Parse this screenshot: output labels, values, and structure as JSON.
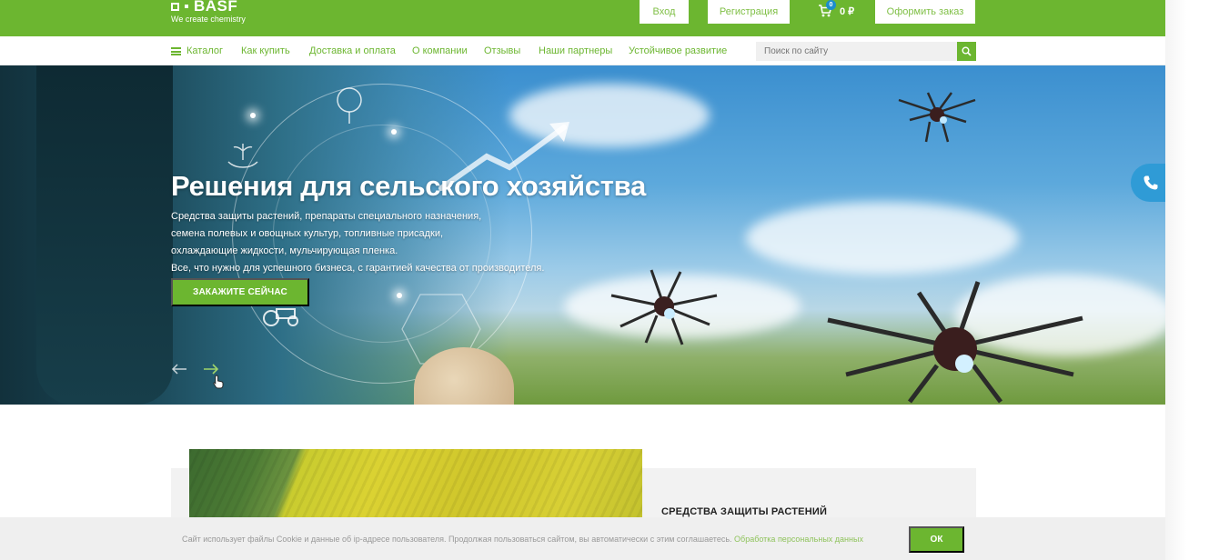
{
  "header": {
    "logo_text": "BASF",
    "logo_tagline": "We create chemistry",
    "login_label": "Вход",
    "register_label": "Регистрация",
    "cart_count": "0",
    "cart_total": "0 ₽",
    "checkout_label": "Оформить заказ",
    "brand_color": "#6cb630"
  },
  "nav": {
    "items": [
      {
        "label": "Каталог"
      },
      {
        "label": "Как купить"
      },
      {
        "label": "Доставка и оплата"
      },
      {
        "label": "О компании"
      },
      {
        "label": "Отзывы"
      },
      {
        "label": "Наши партнеры"
      },
      {
        "label": "Устойчивое развитие"
      }
    ],
    "search_placeholder": "Поиск по сайту"
  },
  "hero": {
    "title": "Решения для сельского хозяйства",
    "lines": [
      "Средства защиты растений, препараты специального назначения,",
      "семена полевых и овощных культур, топливные присадки,",
      "охлаждающие жидкости, мульчирующая пленка.",
      "Все, что нужно для успешного бизнеса, с гарантией качества от производителя."
    ],
    "cta_label": "ЗАКАЖИТЕ СЕЙЧАС"
  },
  "section": {
    "card_title": "СРЕДСТВА ЗАЩИТЫ РАСТЕНИЙ"
  },
  "cookie": {
    "text": "Сайт использует файлы Cookie и данные об ip-адресе пользователя. Продолжая пользоваться сайтом, вы автоматически с этим соглашаетесь.",
    "link_label": "Обработка персональных данных",
    "ok_label": "ОК"
  }
}
